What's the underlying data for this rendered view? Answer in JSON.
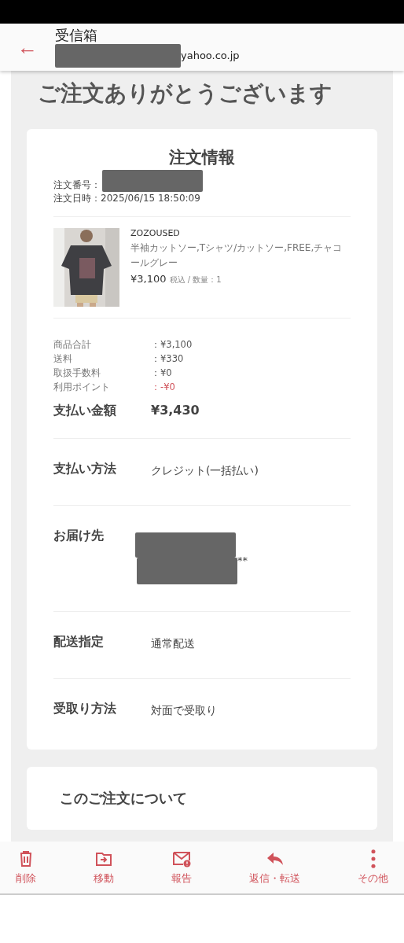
{
  "header": {
    "back": "←",
    "title": "受信箱",
    "sender": "yahoo.co.jp"
  },
  "heading": "ご注文ありがとうございます",
  "order": {
    "title": "注文情報",
    "number_label": "注文番号：",
    "date": "注文日時：2025/06/15 18:50:09"
  },
  "item": {
    "shop": "ZOZOUSED",
    "name": "半袖カットソー,Tシャツ/カットソー,FREE,チャコールグレー",
    "price": "¥3,100",
    "note": "税込 / 数量：1"
  },
  "costs": [
    {
      "label": "商品合計",
      "value": "：¥3,100",
      "negative": false
    },
    {
      "label": "送料",
      "value": "：¥330",
      "negative": false
    },
    {
      "label": "取扱手数料",
      "value": "：¥0",
      "negative": false
    },
    {
      "label": "利用ポイント",
      "value": "：-¥0",
      "negative": true
    }
  ],
  "total": {
    "label": "支払い金額",
    "value": "¥3,430"
  },
  "sections": [
    {
      "label": "支払い方法",
      "value": "クレジット(一括払い)",
      "kind": "text"
    },
    {
      "label": "お届け先",
      "value": "**",
      "kind": "address"
    },
    {
      "label": "配送指定",
      "value": "通常配送",
      "kind": "text"
    },
    {
      "label": "受取り方法",
      "value": "対面で受取り",
      "kind": "text"
    }
  ],
  "about": {
    "title": "このご注文について"
  },
  "toolbar": [
    {
      "kind": "trash",
      "label": "削除"
    },
    {
      "kind": "folder",
      "label": "移動"
    },
    {
      "kind": "mail",
      "label": "報告"
    },
    {
      "kind": "reply",
      "label": "返信・転送"
    },
    {
      "kind": "more",
      "label": "その他"
    }
  ]
}
